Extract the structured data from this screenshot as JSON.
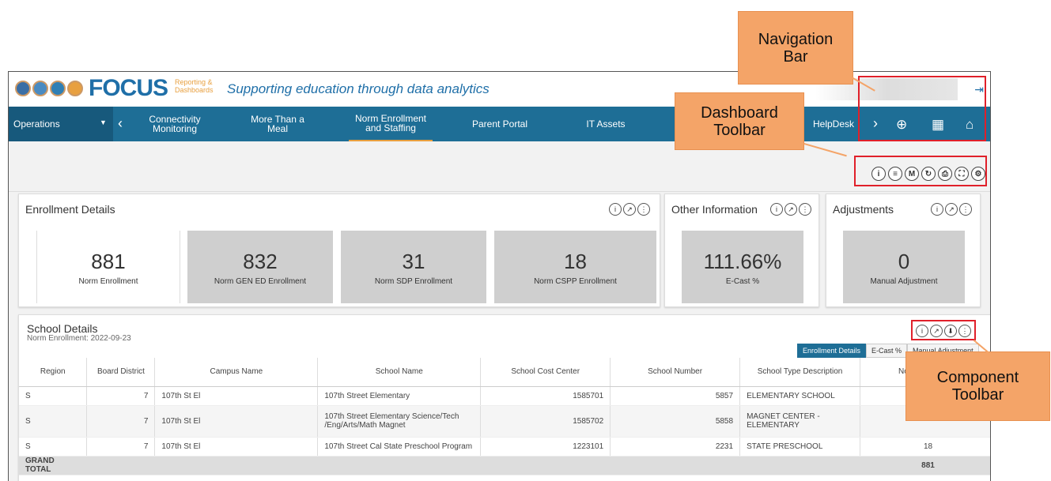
{
  "header": {
    "brand": "FOCUS",
    "brand_sub1": "Reporting &",
    "brand_sub2": "Dashboards",
    "tagline": "Supporting education through data analytics",
    "logout_icon": "logout-icon"
  },
  "nav": {
    "first": "Operations",
    "items": [
      {
        "l1": "Connectivity",
        "l2": "Monitoring"
      },
      {
        "l1": "More Than a",
        "l2": "Meal"
      },
      {
        "l1": "Norm Enrollment",
        "l2": "and Staffing"
      },
      {
        "l1": "Parent Portal",
        "l2": ""
      },
      {
        "l1": "IT Assets",
        "l2": ""
      },
      {
        "l1": "HelpDesk",
        "l2": ""
      }
    ],
    "active": "Norm Enrollment and Staffing"
  },
  "toolbar": {
    "icons": [
      "info-icon",
      "filter-icon",
      "m-icon",
      "refresh-icon",
      "print-icon",
      "fullscreen-icon",
      "settings-icon"
    ]
  },
  "cards": {
    "enrollment": {
      "title": "Enrollment Details",
      "kpis": [
        {
          "value": "881",
          "label": "Norm Enrollment"
        },
        {
          "value": "832",
          "label": "Norm GEN ED Enrollment"
        },
        {
          "value": "31",
          "label": "Norm SDP Enrollment"
        },
        {
          "value": "18",
          "label": "Norm CSPP Enrollment"
        }
      ]
    },
    "other": {
      "title": "Other Information",
      "kpi": {
        "value": "111.66%",
        "label": "E-Cast %"
      }
    },
    "adjust": {
      "title": "Adjustments",
      "kpi": {
        "value": "0",
        "label": "Manual Adjustment"
      }
    }
  },
  "school": {
    "title": "School Details",
    "subtitle": "Norm Enrollment: 2022-09-23",
    "tabs": [
      "Enrollment Details",
      "E-Cast %",
      "Manual Adjustment"
    ],
    "columns": [
      "Region",
      "Board District",
      "Campus Name",
      "School Name",
      "School Cost Center",
      "School Number",
      "School Type Description",
      "Norm Enrollment"
    ],
    "rows": [
      [
        "S",
        "7",
        "107th St El",
        "107th Street Elementary",
        "1585701",
        "5857",
        "ELEMENTARY SCHOOL",
        ""
      ],
      [
        "S",
        "7",
        "107th St El",
        "107th Street Elementary Science/Tech /Eng/Arts/Math Magnet",
        "1585702",
        "5858",
        "MAGNET CENTER - ELEMENTARY",
        ""
      ],
      [
        "S",
        "7",
        "107th St El",
        "107th Street Cal State Preschool Program",
        "1223101",
        "2231",
        "STATE PRESCHOOL",
        "18"
      ]
    ],
    "total_label": "GRAND TOTAL",
    "total_value": "881"
  },
  "callouts": {
    "nav": "Navigation Bar",
    "dash": "Dashboard Toolbar",
    "comp": "Component Toolbar"
  }
}
